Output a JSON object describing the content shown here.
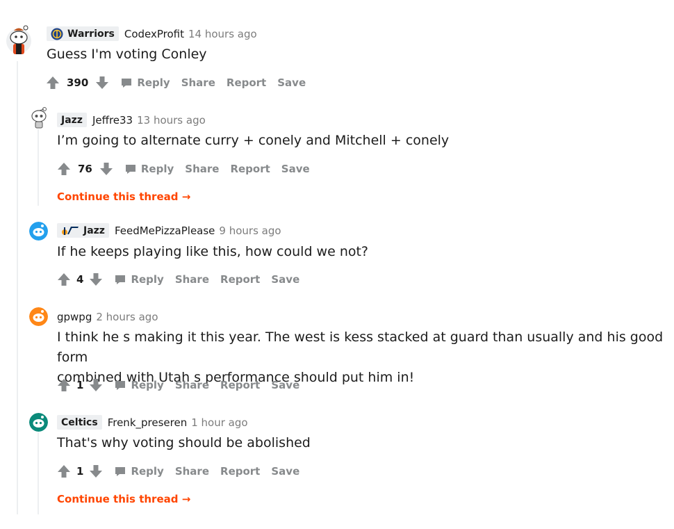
{
  "actions": {
    "reply": "Reply",
    "share": "Share",
    "report": "Report",
    "save": "Save"
  },
  "continue_label": "Continue this thread →",
  "comments": [
    {
      "flair": "Warriors",
      "user": "CodexProfit",
      "time": "14 hours ago",
      "body": "Guess I'm voting Conley",
      "score": "390"
    },
    {
      "flair": "Jazz",
      "user": "Jeffre33",
      "time": "13 hours ago",
      "body": "I’m going to alternate curry + conely and Mitchell + conely",
      "score": "76"
    },
    {
      "flair": "Jazz",
      "user": "FeedMePizzaPlease",
      "time": "9 hours ago",
      "body": "If he keeps playing like this, how could we not?",
      "score": "4"
    },
    {
      "flair": "",
      "user": "gpwpg",
      "time": "2 hours ago",
      "body_lines": [
        "I think he s making it this year. The west is kess stacked at guard than usually and his good form",
        "combined with Utah s performance should put him in!"
      ],
      "score": "1"
    },
    {
      "flair": "Celtics",
      "user": "Frenk_preseren",
      "time": "1 hour ago",
      "body": "That's why voting should be abolished",
      "score": "1"
    }
  ],
  "colors": {
    "accent": "#ff4500",
    "meta": "#7c7c7c",
    "action": "#878a8c",
    "line": "#edeff1"
  },
  "icons": [
    "snoo-avatar-icon",
    "warriors-logo-icon",
    "jazz-logo-icon",
    "upvote-icon",
    "downvote-icon",
    "comment-icon"
  ]
}
